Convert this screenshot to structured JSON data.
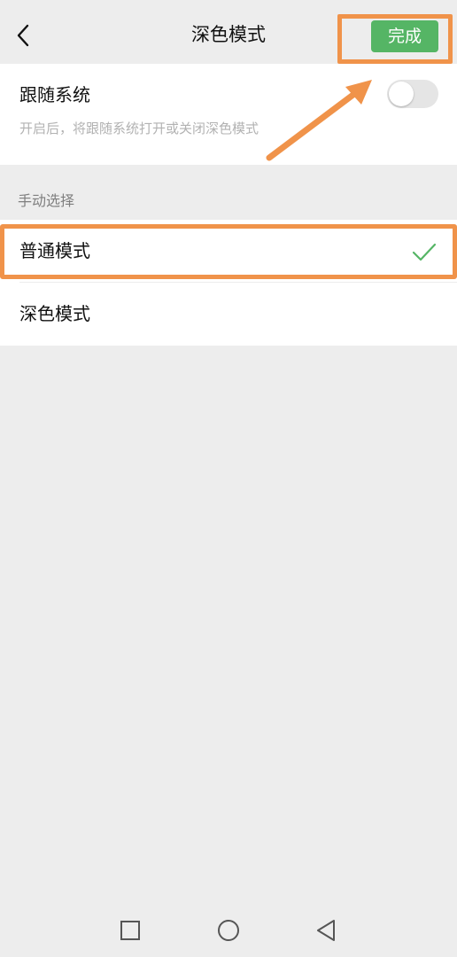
{
  "nav": {
    "title": "深色模式",
    "done_label": "完成",
    "back_icon": "chevron-left-icon"
  },
  "follow_system": {
    "label": "跟随系统",
    "description": "开启后，将跟随系统打开或关闭深色模式",
    "enabled": false
  },
  "manual": {
    "header": "手动选择",
    "options": [
      {
        "label": "普通模式",
        "selected": true
      },
      {
        "label": "深色模式",
        "selected": false
      }
    ]
  },
  "system_nav": {
    "keys": [
      "recent-apps-icon",
      "home-icon",
      "back-triangle-icon"
    ]
  },
  "colors": {
    "accent_green": "#55b565",
    "highlight_orange": "#f0934a",
    "background": "#ededed"
  }
}
